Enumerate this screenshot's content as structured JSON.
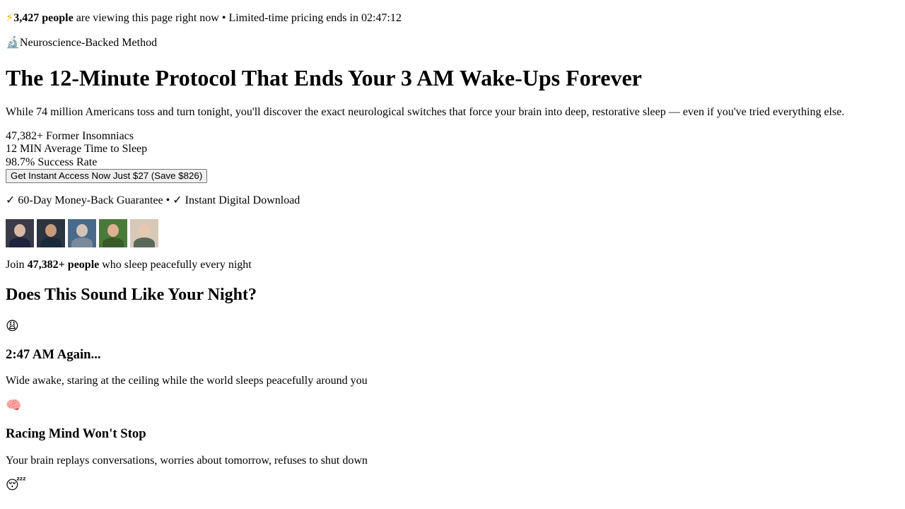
{
  "top_bar": {
    "icon": "lightning-icon",
    "viewers_bold": "3,427 people",
    "viewers_text": " are viewing this page right now • Limited-time pricing ends in ",
    "timer": "02:47:12"
  },
  "badge": {
    "icon": "microscope-icon",
    "label": "Neuroscience-Backed Method"
  },
  "hero": {
    "title": "The 12-Minute Protocol That Ends Your 3 AM Wake-Ups Forever",
    "subtitle": "While 74 million Americans toss and turn tonight, you'll discover the exact neurological switches that force your brain into deep, restorative sleep — even if you've tried everything else."
  },
  "stats": [
    {
      "value": "47,382+",
      "label": "Former Insomniacs"
    },
    {
      "value": "12 MIN",
      "label": "Average Time to Sleep"
    },
    {
      "value": "98.7%",
      "label": "Success Rate"
    }
  ],
  "cta": {
    "label": "Get Instant Access Now Just $27 (Save $826)"
  },
  "guarantee": {
    "text": "✓ 60-Day Money-Back Guarantee • ✓ Instant Digital Download"
  },
  "social_proof": {
    "avatars": [
      {
        "bg": "#3a3a48",
        "skin": "#d8b8a0",
        "body": "#1e2440"
      },
      {
        "bg": "#2c3440",
        "skin": "#c89a78",
        "body": "#1a2a3a"
      },
      {
        "bg": "#4a6a8a",
        "skin": "#d4c4b8",
        "body": "#7a8a9a"
      },
      {
        "bg": "#4a7a3a",
        "skin": "#e0b090",
        "body": "#3a5a2a"
      },
      {
        "bg": "#d8c8b8",
        "skin": "#e8c8b0",
        "body": "#5a6a5a"
      }
    ],
    "join_prefix": "Join ",
    "join_bold": "47,382+ people",
    "join_suffix": " who sleep peacefully every night"
  },
  "problems": {
    "heading": "Does This Sound Like Your Night?",
    "items": [
      {
        "icon": "😩",
        "icon_name": "weary-face-icon",
        "title": "2:47 AM Again...",
        "text": "Wide awake, staring at the ceiling while the world sleeps peacefully around you"
      },
      {
        "icon": "🧠",
        "icon_name": "brain-icon",
        "title": "Racing Mind Won't Stop",
        "text": "Your brain replays conversations, worries about tomorrow, refuses to shut down"
      },
      {
        "icon": "😴",
        "icon_name": "sleeping-face-icon",
        "title": "",
        "text": ""
      }
    ]
  },
  "colors": {
    "text": "#000000",
    "background": "#ffffff",
    "button_bg": "#efefef",
    "button_border": "#767676"
  }
}
